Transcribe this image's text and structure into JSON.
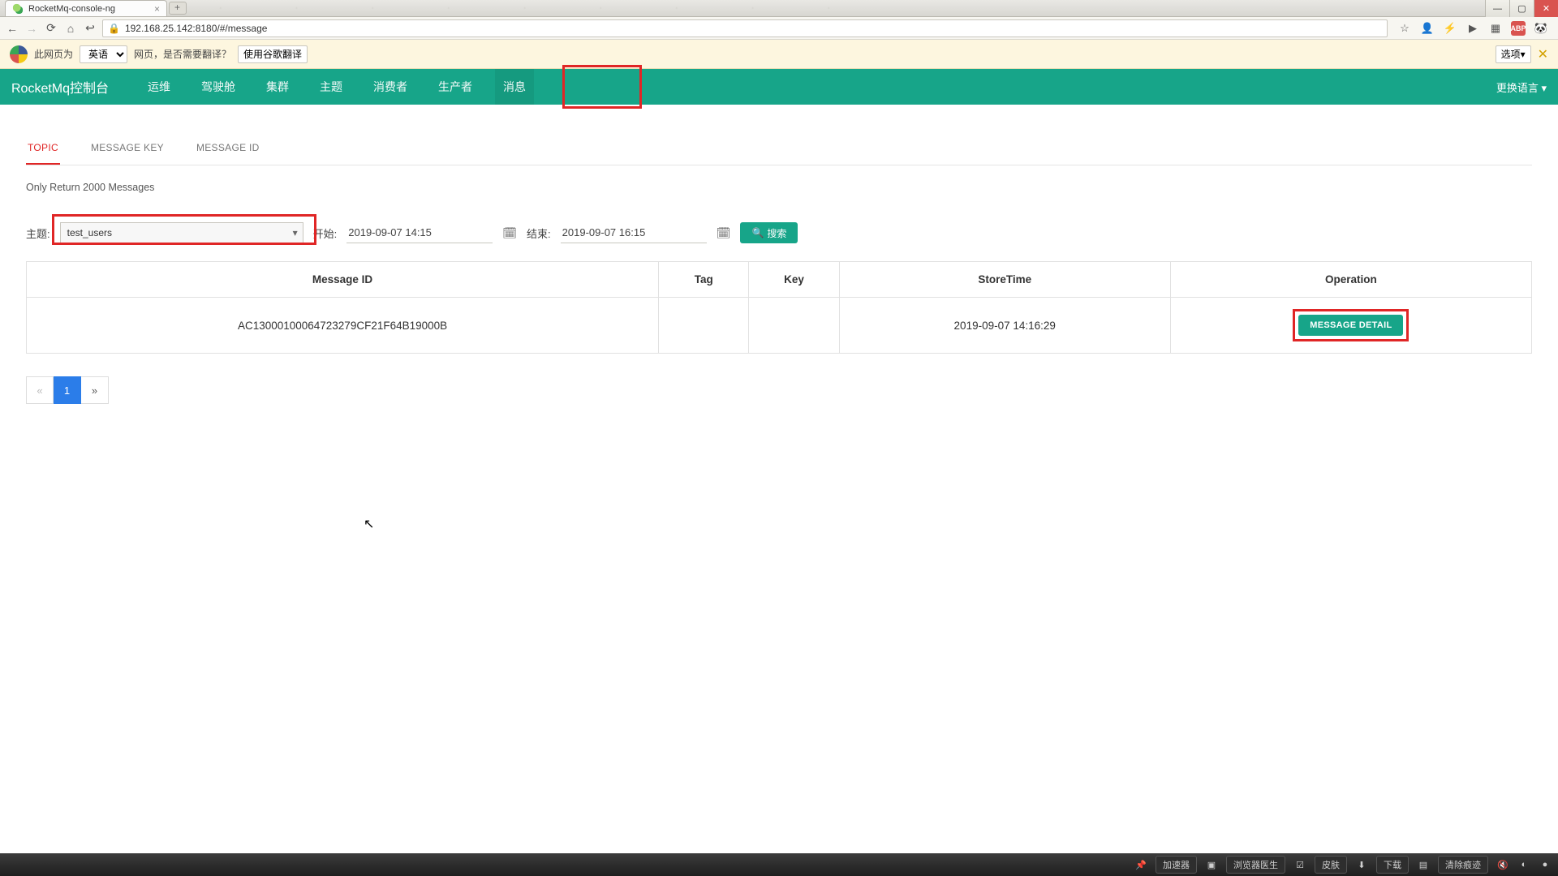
{
  "browser": {
    "tab_title": "RocketMq-console-ng",
    "url": "192.168.25.142:8180/#/message",
    "win_controls": {
      "min": "—",
      "max": "▢",
      "close": "✕"
    }
  },
  "toolbar_icons": {
    "back": "←",
    "fwd": "→",
    "reload": "⟳",
    "home": "⌂",
    "undo": "↩",
    "star": "☆",
    "user": "👤",
    "bolt": "⚡",
    "play": "▶",
    "grid": "▦",
    "abp": "ABP",
    "panda": "🐼"
  },
  "translate": {
    "prefix": "此网页为",
    "lang": "英语",
    "suffix": "网页，是否需要翻译？",
    "do_btn": "使用谷歌翻译",
    "options": "选项▾"
  },
  "app": {
    "brand": "RocketMq控制台",
    "nav": [
      "运维",
      "驾驶舱",
      "集群",
      "主题",
      "消费者",
      "生产者",
      "消息"
    ],
    "nav_active_index": 6,
    "lang_switch": "更换语言 ▾"
  },
  "subtabs": {
    "items": [
      "TOPIC",
      "MESSAGE KEY",
      "MESSAGE ID"
    ],
    "active_index": 0
  },
  "hint": "Only Return 2000 Messages",
  "filters": {
    "topic_label": "主题:",
    "topic_value": "test_users",
    "begin_label": "开始:",
    "begin_value": "2019-09-07 14:15",
    "end_label": "结束:",
    "end_value": "2019-09-07 16:15",
    "search_btn": "搜索"
  },
  "table": {
    "headers": [
      "Message ID",
      "Tag",
      "Key",
      "StoreTime",
      "Operation"
    ],
    "rows": [
      {
        "message_id": "AC13000100064723279CF21F64B19000B",
        "tag": "",
        "key": "",
        "store_time": "2019-09-07 14:16:29",
        "op_label": "MESSAGE DETAIL"
      }
    ]
  },
  "pager": {
    "prev": "«",
    "pages": [
      "1"
    ],
    "next": "»",
    "active_index": 0
  },
  "taskbar": {
    "items": [
      "加速器",
      "▣",
      "浏览器医生",
      "☑",
      "皮肤",
      "⬇",
      "下载",
      "▤",
      "清除痕迹",
      "🔇",
      "◐",
      "●"
    ]
  }
}
